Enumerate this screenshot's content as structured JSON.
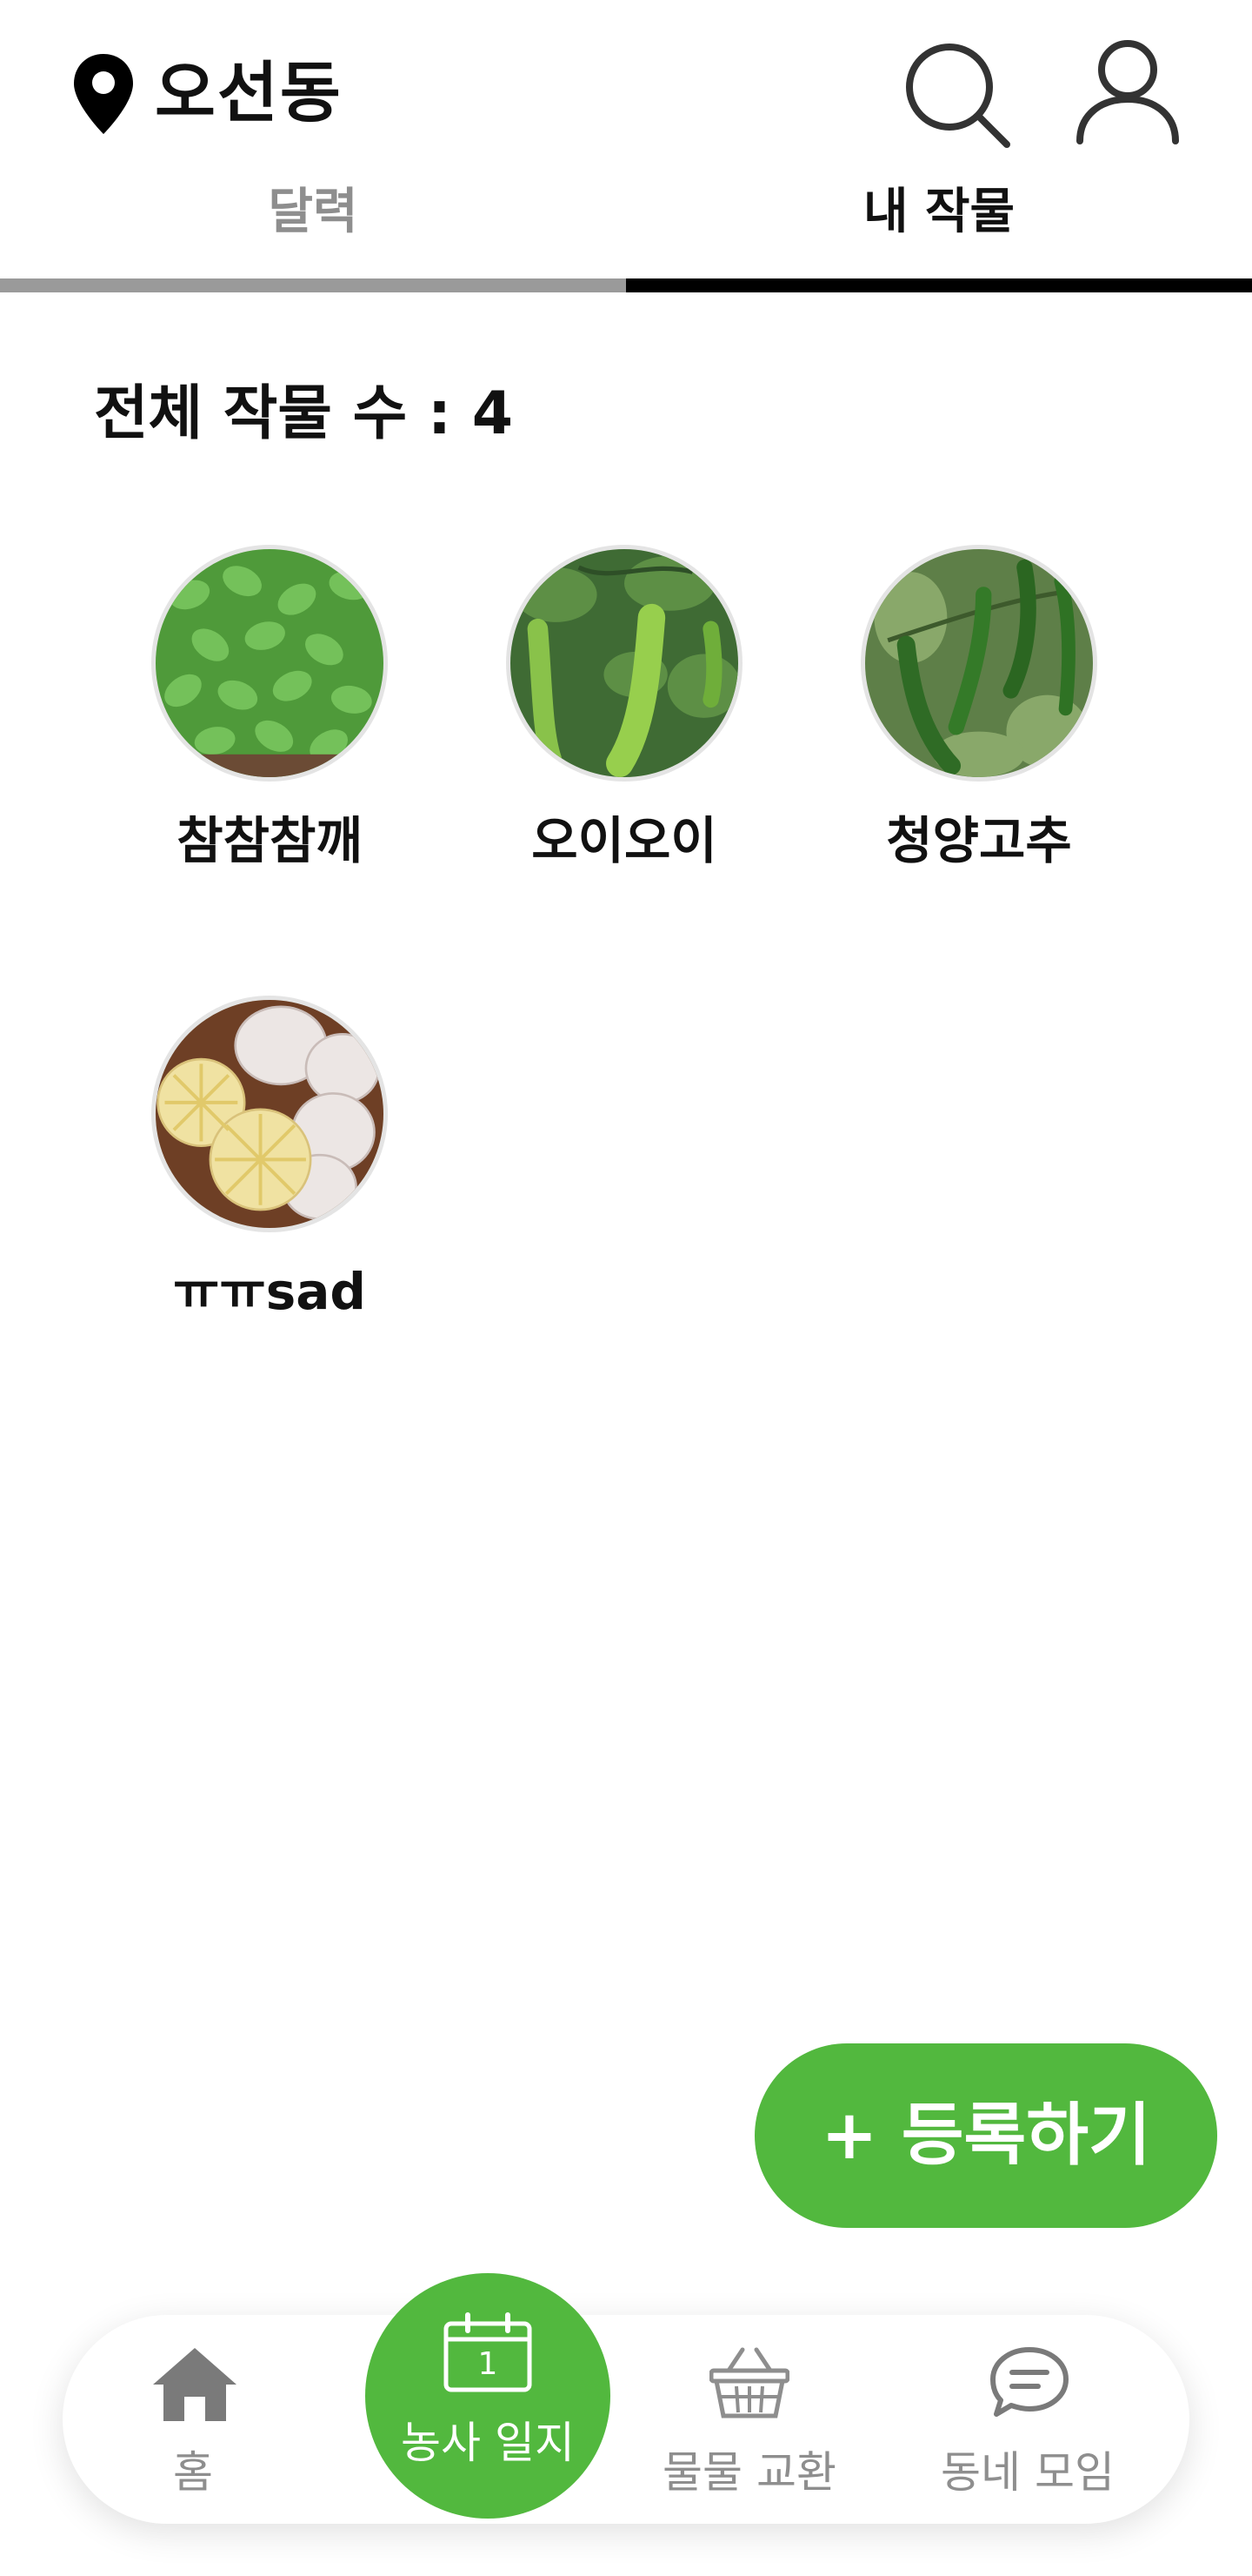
{
  "header": {
    "location": "오선동",
    "pin_icon": "location-pin-icon",
    "search_icon": "search-icon",
    "profile_icon": "user-icon"
  },
  "tabs": [
    {
      "label": "달력",
      "active": false
    },
    {
      "label": "내 작물",
      "active": true
    }
  ],
  "summary": {
    "count_text": "전체 작물 수 : 4"
  },
  "crops": [
    {
      "name": "참참참깨",
      "image": "sesame-seedlings"
    },
    {
      "name": "오이오이",
      "image": "cucumbers"
    },
    {
      "name": "청양고추",
      "image": "green-chili-peppers"
    },
    {
      "name": "ㅠㅠsad",
      "image": "garlic-bulbs"
    }
  ],
  "actions": {
    "register_label": "+ 등록하기"
  },
  "bottom_nav": {
    "items": [
      {
        "label": "홈",
        "icon": "home-icon"
      },
      {
        "label": "농사 일지",
        "icon": "calendar-icon",
        "calendar_day": "1"
      },
      {
        "label": "물물 교환",
        "icon": "basket-icon"
      },
      {
        "label": "동네 모임",
        "icon": "chat-bubble-icon"
      }
    ]
  },
  "colors": {
    "accent": "#52b83e",
    "inactive_text": "#8e8e8e",
    "active_tab_bar": "#000000",
    "inactive_tab_bar": "#9a9a9a"
  }
}
